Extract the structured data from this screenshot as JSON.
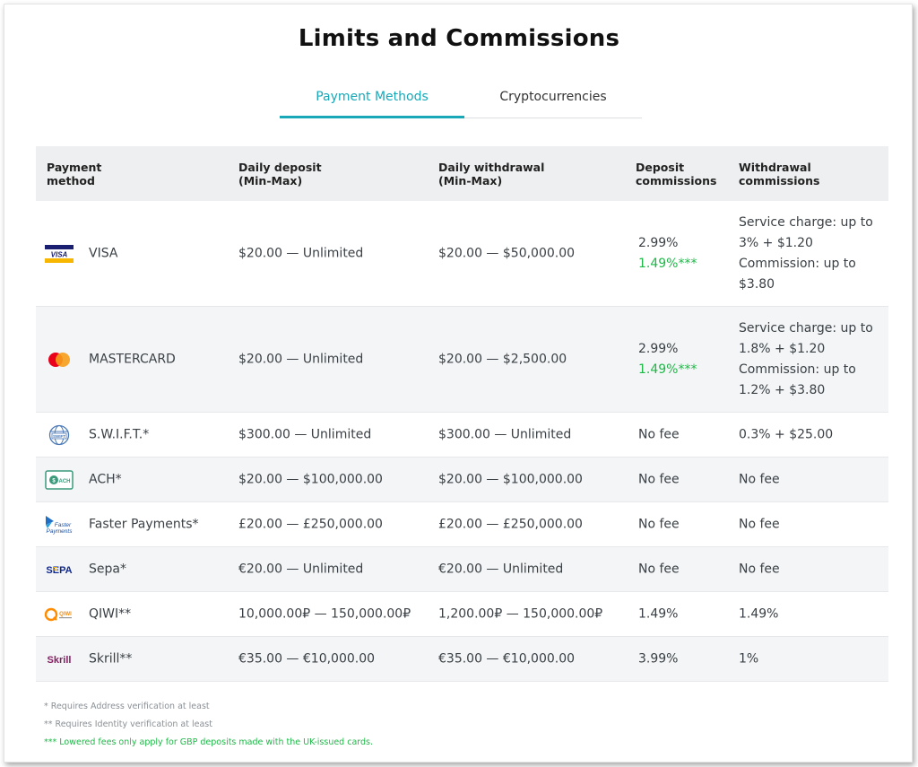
{
  "title": "Limits and Commissions",
  "tabs": [
    {
      "label": "Payment Methods",
      "active": true
    },
    {
      "label": "Cryptocurrencies",
      "active": false
    }
  ],
  "columns": {
    "method": [
      "Payment",
      "method"
    ],
    "deposit": [
      "Daily deposit",
      "(Min-Max)"
    ],
    "withdrawal": [
      "Daily withdrawal",
      "(Min-Max)"
    ],
    "dep_comm": [
      "Deposit",
      "commissions"
    ],
    "wd_comm": [
      "Withdrawal",
      "commissions"
    ]
  },
  "rows": [
    {
      "name": "VISA",
      "icon": "visa-icon",
      "deposit": "$20.00 — Unlimited",
      "withdrawal": "$20.00 — $50,000.00",
      "dep1": "2.99%",
      "dep2": "1.49%***",
      "wd": [
        "Service charge: up to",
        "3% + $1.20",
        "Commission: up to",
        "$3.80"
      ]
    },
    {
      "name": "MASTERCARD",
      "icon": "mastercard-icon",
      "deposit": "$20.00 — Unlimited",
      "withdrawal": "$20.00 — $2,500.00",
      "dep1": "2.99%",
      "dep2": "1.49%***",
      "wd": [
        "Service charge: up to",
        "1.8% + $1.20",
        "Commission: up to",
        "1.2% + $3.80"
      ]
    },
    {
      "name": "S.W.I.F.T.*",
      "icon": "swift-icon",
      "deposit": "$300.00 — Unlimited",
      "withdrawal": "$300.00 — Unlimited",
      "dep1": "No fee",
      "wd1": "0.3% + $25.00"
    },
    {
      "name": "ACH*",
      "icon": "ach-icon",
      "deposit": "$20.00 — $100,000.00",
      "withdrawal": "$20.00 — $100,000.00",
      "dep1": "No fee",
      "wd1": "No fee"
    },
    {
      "name": "Faster Payments*",
      "icon": "faster-payments-icon",
      "deposit": "£20.00 — £250,000.00",
      "withdrawal": "£20.00 — £250,000.00",
      "dep1": "No fee",
      "wd1": "No fee"
    },
    {
      "name": "Sepa*",
      "icon": "sepa-icon",
      "deposit": "€20.00 — Unlimited",
      "withdrawal": "€20.00 — Unlimited",
      "dep1": "No fee",
      "wd1": "No fee"
    },
    {
      "name": "QIWI**",
      "icon": "qiwi-icon",
      "deposit": "10,000.00₽ — 150,000.00₽",
      "withdrawal": "1,200.00₽ — 150,000.00₽",
      "dep1": "1.49%",
      "wd1": "1.49%"
    },
    {
      "name": "Skrill**",
      "icon": "skrill-icon",
      "deposit": "€35.00 — €10,000.00",
      "withdrawal": "€35.00 — €10,000.00",
      "dep1": "3.99%",
      "wd1": "1%"
    }
  ],
  "logo_text": {
    "visa": "VISA",
    "swift": "SWIFT",
    "ach": "ACH",
    "faster": [
      "Faster",
      "Payments"
    ],
    "sepa": "SEPA",
    "qiwi": "QIWI",
    "skrill": "Skrill"
  },
  "footnotes": [
    "* Requires Address verification at least",
    "** Requires Identity verification at least",
    "*** Lowered fees only apply for GBP deposits made with the UK-issued cards."
  ],
  "colors": {
    "accent": "#18a8b8",
    "green": "#1fb848"
  }
}
